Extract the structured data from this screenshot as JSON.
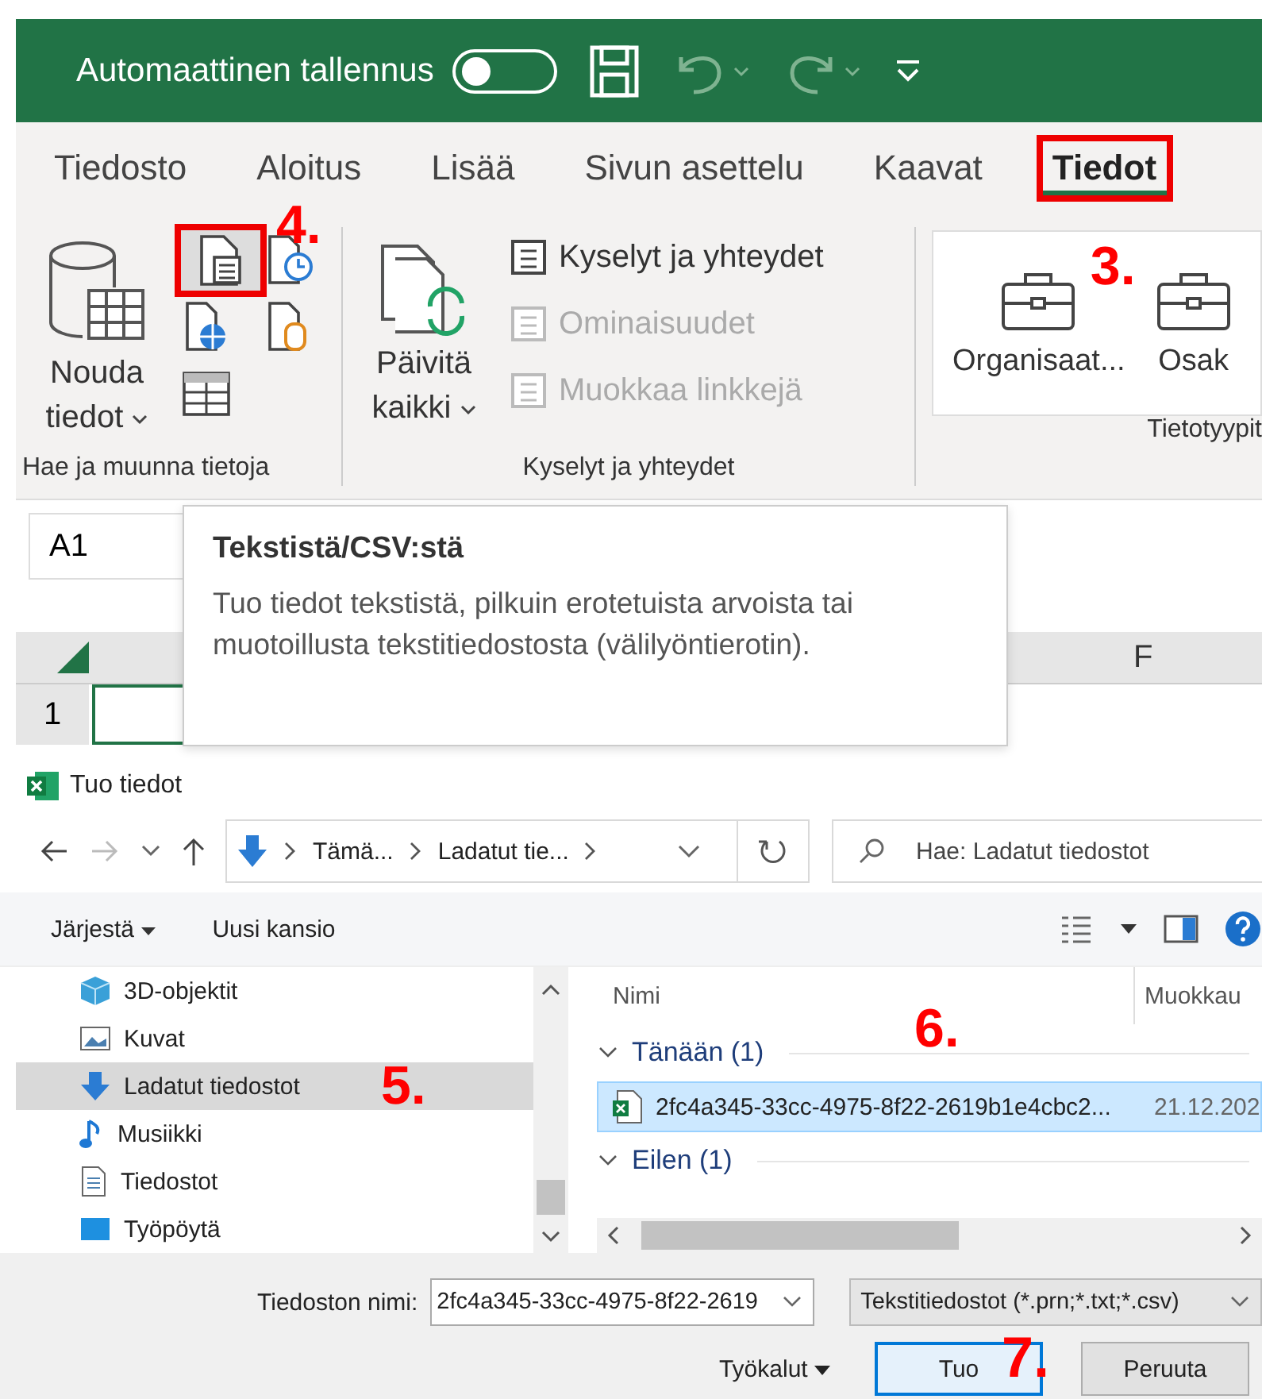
{
  "title_bar": {
    "autosave_label": "Automaattinen tallennus",
    "autosave_on": false
  },
  "tabs": [
    {
      "label": "Tiedosto",
      "selected": false,
      "highlighted": false
    },
    {
      "label": "Aloitus",
      "selected": false,
      "highlighted": false
    },
    {
      "label": "Lisää",
      "selected": false,
      "highlighted": false
    },
    {
      "label": "Sivun asettelu",
      "selected": false,
      "highlighted": false
    },
    {
      "label": "Kaavat",
      "selected": false,
      "highlighted": false
    },
    {
      "label": "Tiedot",
      "selected": true,
      "highlighted": true,
      "callout": "3."
    }
  ],
  "ribbon": {
    "get_group": {
      "label": "Hae ja muunna tietoja",
      "button": "Nouda tiedot",
      "text_csv_highlighted": true,
      "callout": "4."
    },
    "queries_group": {
      "label": "Kyselyt ja yhteydet",
      "button": "Päivitä kaikki",
      "items": [
        {
          "label": "Kyselyt ja yhteydet",
          "disabled": false
        },
        {
          "label": "Ominaisuudet",
          "disabled": true
        },
        {
          "label": "Muokkaa linkkejä",
          "disabled": true
        }
      ]
    },
    "types_group": {
      "label": "Tietotyypit",
      "items": [
        "Organisaat...",
        "Osak"
      ]
    }
  },
  "sheet": {
    "name_box": "A1",
    "column": "F",
    "row": "1"
  },
  "tooltip": {
    "title": "Tekstistä/CSV:stä",
    "text": "Tuo tiedot tekstistä, pilkuin erotetuista arvoista tai muotoillusta tekstitiedostosta (välilyöntierotin)."
  },
  "dialog": {
    "title": "Tuo tiedot",
    "path": [
      "Tämä...",
      "Ladatut tie..."
    ],
    "search_placeholder": "Hae: Ladatut tiedostot",
    "organize": "Järjestä",
    "new_folder": "Uusi kansio",
    "nav": [
      {
        "label": "3D-objektit",
        "selected": false
      },
      {
        "label": "Kuvat",
        "selected": false
      },
      {
        "label": "Ladatut tiedostot",
        "selected": true,
        "callout": "5."
      },
      {
        "label": "Musiikki",
        "selected": false
      },
      {
        "label": "Tiedostot",
        "selected": false
      },
      {
        "label": "Työpöytä",
        "selected": false
      }
    ],
    "columns": [
      "Nimi",
      "Muokkau"
    ],
    "groups": [
      {
        "label": "Tänään (1)",
        "expanded": true,
        "callout": "6.",
        "files": [
          {
            "name": "2fc4a345-33cc-4975-8f22-2619b1e4cbc2...",
            "modified": "21.12.202",
            "selected": true
          }
        ]
      },
      {
        "label": "Eilen (1)",
        "expanded": true
      }
    ],
    "file_name_label": "Tiedoston nimi:",
    "file_name": "2fc4a345-33cc-4975-8f22-2619",
    "file_type": "Tekstitiedostot (*.prn;*.txt;*.csv)",
    "tools": "Työkalut",
    "buttons": [
      {
        "label": "Tuo",
        "kind": "primary",
        "callout": "7."
      },
      {
        "label": "Peruuta",
        "kind": "secondary"
      }
    ]
  }
}
